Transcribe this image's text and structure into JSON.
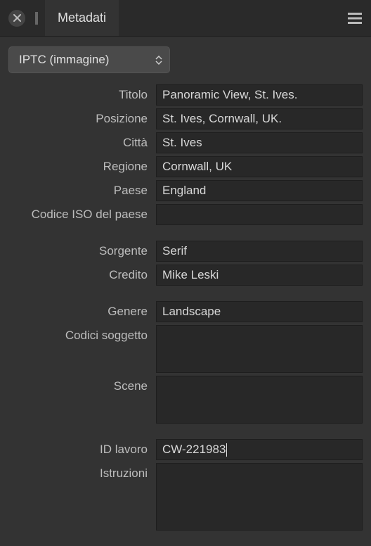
{
  "header": {
    "tab_title": "Metadati"
  },
  "dropdown": {
    "selected": "IPTC (immagine)"
  },
  "groups": [
    {
      "rows": [
        {
          "label": "Titolo",
          "value": "Panoramic View, St. Ives."
        },
        {
          "label": "Posizione",
          "value": "St. Ives, Cornwall, UK."
        },
        {
          "label": "Città",
          "value": "St. Ives"
        },
        {
          "label": "Regione",
          "value": "Cornwall, UK"
        },
        {
          "label": "Paese",
          "value": "England"
        },
        {
          "label": "Codice ISO del paese",
          "value": ""
        }
      ]
    },
    {
      "rows": [
        {
          "label": "Sorgente",
          "value": "Serif"
        },
        {
          "label": "Credito",
          "value": "Mike Leski"
        }
      ]
    },
    {
      "rows": [
        {
          "label": "Genere",
          "value": "Landscape",
          "type": "input"
        },
        {
          "label": "Codici soggetto",
          "value": "",
          "type": "textarea68"
        },
        {
          "label": "Scene",
          "value": "",
          "type": "textarea68"
        }
      ]
    },
    {
      "rows": [
        {
          "label": "ID lavoro",
          "value": "CW-221983",
          "type": "input-caret"
        },
        {
          "label": "Istruzioni",
          "value": "",
          "type": "textarea96"
        }
      ]
    }
  ]
}
